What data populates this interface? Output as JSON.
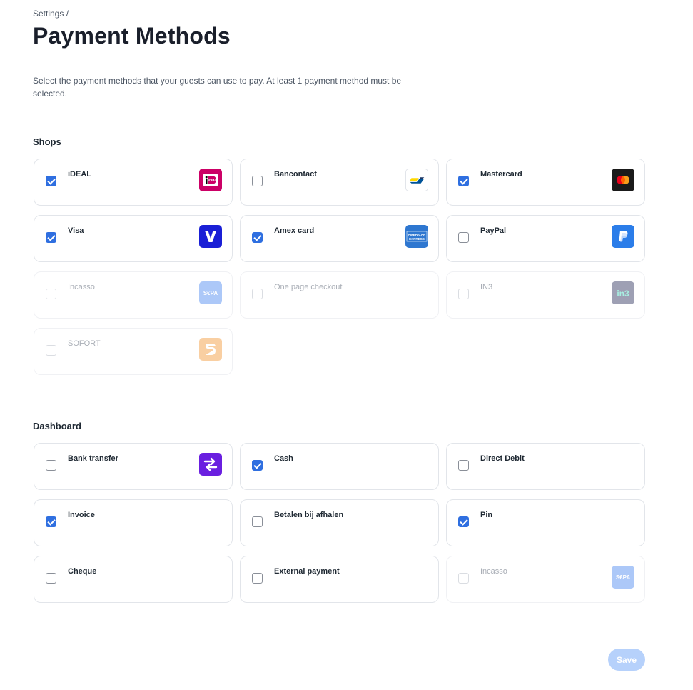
{
  "breadcrumb": "Settings /",
  "title": "Payment Methods",
  "description": "Select the payment methods that your guests can use to pay. At least 1 payment method must be selected.",
  "shops": {
    "title": "Shops",
    "items": [
      {
        "label": "iDEAL",
        "checked": true,
        "disabled": false,
        "icon": "ideal-icon"
      },
      {
        "label": "Bancontact",
        "checked": false,
        "disabled": false,
        "icon": "bancontact-icon"
      },
      {
        "label": "Mastercard",
        "checked": true,
        "disabled": false,
        "icon": "mastercard-icon"
      },
      {
        "label": "Visa",
        "checked": true,
        "disabled": false,
        "icon": "visa-icon"
      },
      {
        "label": "Amex card",
        "checked": true,
        "disabled": false,
        "icon": "amex-icon"
      },
      {
        "label": "PayPal",
        "checked": false,
        "disabled": false,
        "icon": "paypal-icon"
      },
      {
        "label": "Incasso",
        "checked": false,
        "disabled": true,
        "icon": "sepa-icon"
      },
      {
        "label": "One page checkout",
        "checked": false,
        "disabled": true,
        "icon": ""
      },
      {
        "label": "IN3",
        "checked": false,
        "disabled": true,
        "icon": "in3-icon"
      },
      {
        "label": "SOFORT",
        "checked": false,
        "disabled": true,
        "icon": "sofort-icon"
      }
    ]
  },
  "dashboard": {
    "title": "Dashboard",
    "items": [
      {
        "label": "Bank transfer",
        "checked": false,
        "disabled": false,
        "icon": "bank-transfer-icon"
      },
      {
        "label": "Cash",
        "checked": true,
        "disabled": false,
        "icon": ""
      },
      {
        "label": "Direct Debit",
        "checked": false,
        "disabled": false,
        "icon": ""
      },
      {
        "label": "Invoice",
        "checked": true,
        "disabled": false,
        "icon": ""
      },
      {
        "label": "Betalen bij afhalen",
        "checked": false,
        "disabled": false,
        "icon": ""
      },
      {
        "label": "Pin",
        "checked": true,
        "disabled": false,
        "icon": ""
      },
      {
        "label": "Cheque",
        "checked": false,
        "disabled": false,
        "icon": ""
      },
      {
        "label": "External payment",
        "checked": false,
        "disabled": false,
        "icon": ""
      },
      {
        "label": "Incasso",
        "checked": false,
        "disabled": true,
        "icon": "sepa-icon"
      }
    ]
  },
  "save_label": "Save",
  "logo_text": {
    "sepa": "S€PA",
    "in3": "in3",
    "amex": "AMERICAN EXPRESS",
    "ideal": "iDEAL"
  },
  "colors": {
    "accent": "#2f6fe0",
    "save_disabled": "#b6d1fb"
  }
}
